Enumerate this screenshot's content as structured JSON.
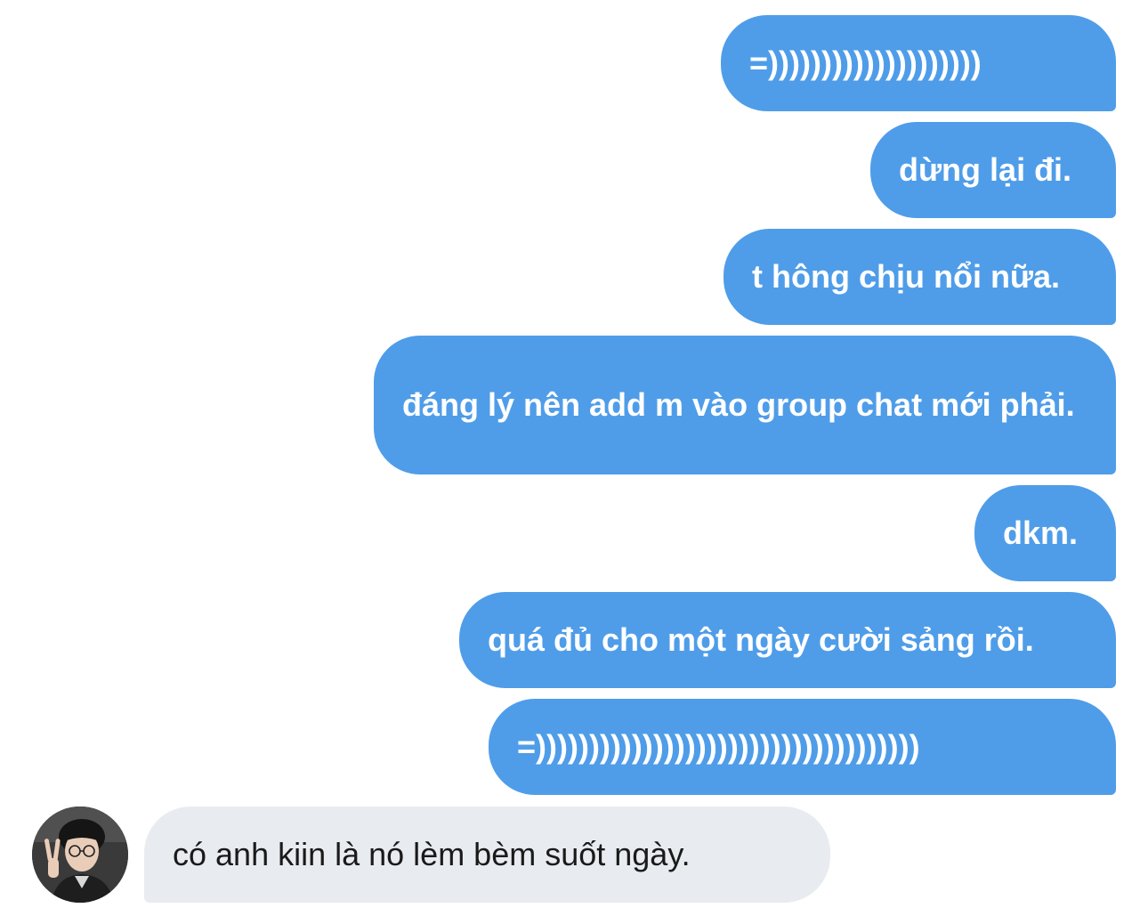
{
  "conversation": {
    "sent_messages": [
      "=))))))))))))))))))))",
      "dừng lại đi.",
      "t hông chịu nổi nữa.",
      "đáng lý nên add m vào group chat mới phải.",
      "dkm.",
      "quá đủ cho một ngày cười sảng rồi.",
      "=))))))))))))))))))))))))))))))))))))"
    ],
    "received_messages": [
      "có anh kiin là nó lèm bèm suốt ngày."
    ],
    "avatar_icon": "contact-avatar-photo"
  },
  "colors": {
    "sent_bubble": "#4f9de9",
    "received_bubble": "#e8ecf0"
  }
}
